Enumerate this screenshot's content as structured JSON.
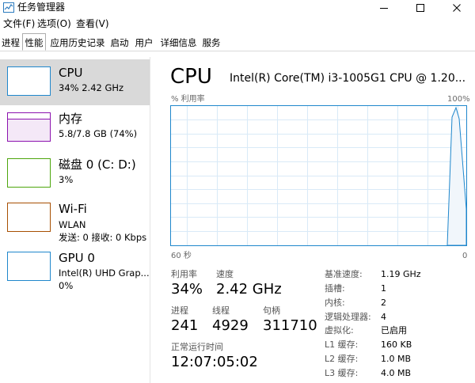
{
  "window": {
    "title": "任务管理器"
  },
  "menu": [
    "文件(F)",
    "选项(O)",
    "查看(V)"
  ],
  "tabs": [
    "进程",
    "性能",
    "应用历史记录",
    "启动",
    "用户",
    "详细信息",
    "服务"
  ],
  "active_tab_index": 1,
  "colors": {
    "cpu": "#1f87cc",
    "memory": "#8b12ae",
    "disk": "#4da60c",
    "wifi": "#a74f01",
    "gpu": "#1f87cc",
    "grid": "#d9eaf7",
    "selected": "#d9d9d9"
  },
  "sidebar": {
    "items": [
      {
        "name": "CPU",
        "line1": "34% 2.42 GHz",
        "line2": "",
        "color": "cpu",
        "selected": true
      },
      {
        "name": "内存",
        "line1": "5.8/7.8 GB (74%)",
        "line2": "",
        "color": "memory",
        "selected": false
      },
      {
        "name": "磁盘 0 (C: D:)",
        "line1": "3%",
        "line2": "",
        "color": "disk",
        "selected": false
      },
      {
        "name": "Wi-Fi",
        "line1": "WLAN",
        "line2": "发送: 0 接收: 0 Kbps",
        "color": "wifi",
        "selected": false
      },
      {
        "name": "GPU 0",
        "line1": "Intel(R) UHD Grap...",
        "line2": "0%",
        "color": "gpu",
        "selected": false
      }
    ]
  },
  "main": {
    "title": "CPU",
    "model": "Intel(R) Core(TM) i3-1005G1 CPU @ 1.20...",
    "graph": {
      "y_label": "% 利用率",
      "y_max_label": "100%",
      "x_left_label": "60 秒",
      "x_right_label": "0"
    },
    "stats": {
      "utilization_label": "利用率",
      "utilization": "34%",
      "speed_label": "速度",
      "speed": "2.42 GHz",
      "processes_label": "进程",
      "processes": "241",
      "threads_label": "线程",
      "threads": "4929",
      "handles_label": "句柄",
      "handles": "311710",
      "uptime_label": "正常运行时间",
      "uptime": "12:07:05:02"
    },
    "specs": [
      {
        "label": "基准速度:",
        "value": "1.19 GHz"
      },
      {
        "label": "插槽:",
        "value": "1"
      },
      {
        "label": "内核:",
        "value": "2"
      },
      {
        "label": "逻辑处理器:",
        "value": "4"
      },
      {
        "label": "虚拟化:",
        "value": "已启用"
      },
      {
        "label": "L1 缓存:",
        "value": "160 KB"
      },
      {
        "label": "L2 缓存:",
        "value": "1.0 MB"
      },
      {
        "label": "L3 缓存:",
        "value": "4.0 MB"
      }
    ]
  }
}
